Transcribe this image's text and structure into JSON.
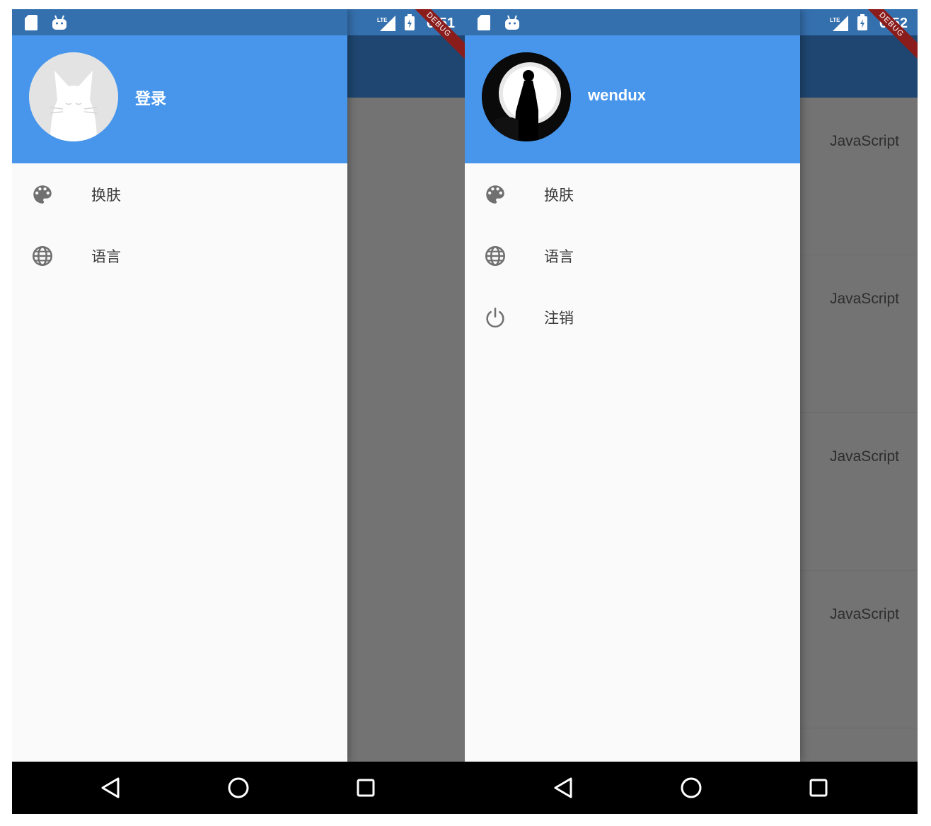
{
  "left_screen": {
    "status": {
      "time": "6:51",
      "debug": "DEBUG"
    },
    "drawer": {
      "header_name": "登录",
      "items": [
        {
          "icon": "palette-icon",
          "label": "换肤"
        },
        {
          "icon": "globe-icon",
          "label": "语言"
        }
      ]
    }
  },
  "right_screen": {
    "status": {
      "time": "6:52",
      "debug": "DEBUG"
    },
    "drawer": {
      "header_name": "wendux",
      "items": [
        {
          "icon": "palette-icon",
          "label": "换肤"
        },
        {
          "icon": "globe-icon",
          "label": "语言"
        },
        {
          "icon": "power-icon",
          "label": "注销"
        }
      ]
    },
    "list_items": [
      "JavaScript",
      "JavaScript",
      "JavaScript",
      "JavaScript"
    ]
  },
  "colors": {
    "header": "#4796eb",
    "status_bar": "#3570ae",
    "app_bar": "#1e4670",
    "scrim": "#737373",
    "nav_bar": "#000000",
    "debug_banner": "#8b1c1c"
  },
  "nav": {
    "icons": [
      "back-icon",
      "home-icon",
      "recents-icon"
    ]
  }
}
